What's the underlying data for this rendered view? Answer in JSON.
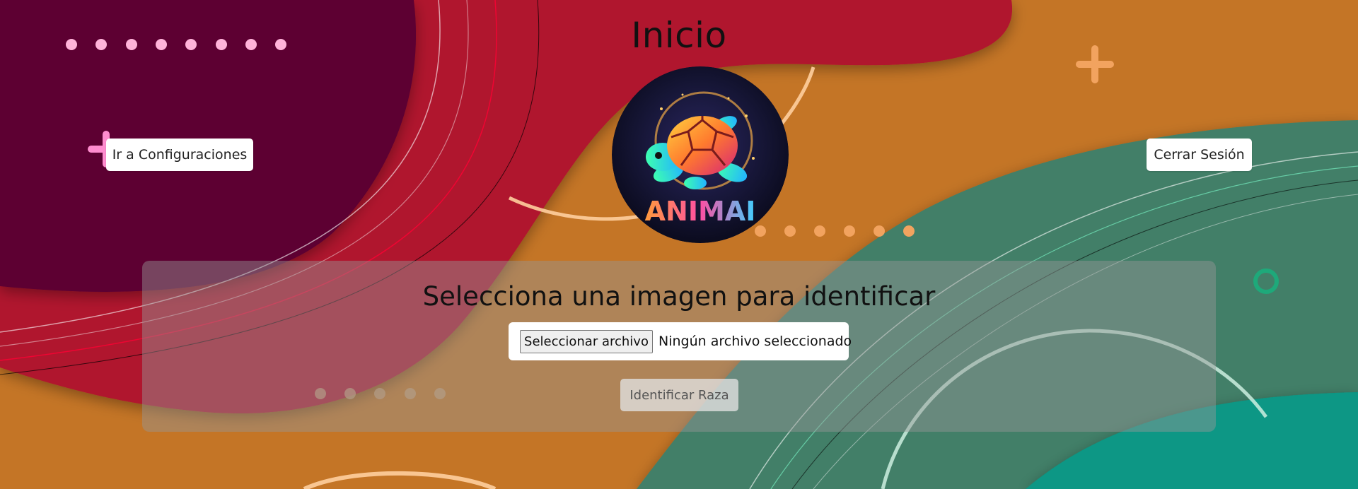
{
  "header": {
    "title": "Inicio"
  },
  "nav": {
    "settings_label": "Ir a Configuraciones",
    "logout_label": "Cerrar Sesión"
  },
  "logo": {
    "text": "ANIMAI",
    "icon": "turtle-logo-icon"
  },
  "upload": {
    "heading": "Selecciona una imagen para identificar",
    "file_button_label": "Seleccionar archivo",
    "file_status": "Ningún archivo seleccionado",
    "submit_label": "Identificar Raza",
    "submit_enabled": false
  },
  "colors": {
    "plum": "#5d0533",
    "crimson": "#b0142e",
    "orange": "#c47526",
    "green": "#427f67",
    "teal": "#079785",
    "pink_dot": "#ffb3d9",
    "plus_orange": "#f2a35f",
    "ring_green": "#1ea97a"
  }
}
